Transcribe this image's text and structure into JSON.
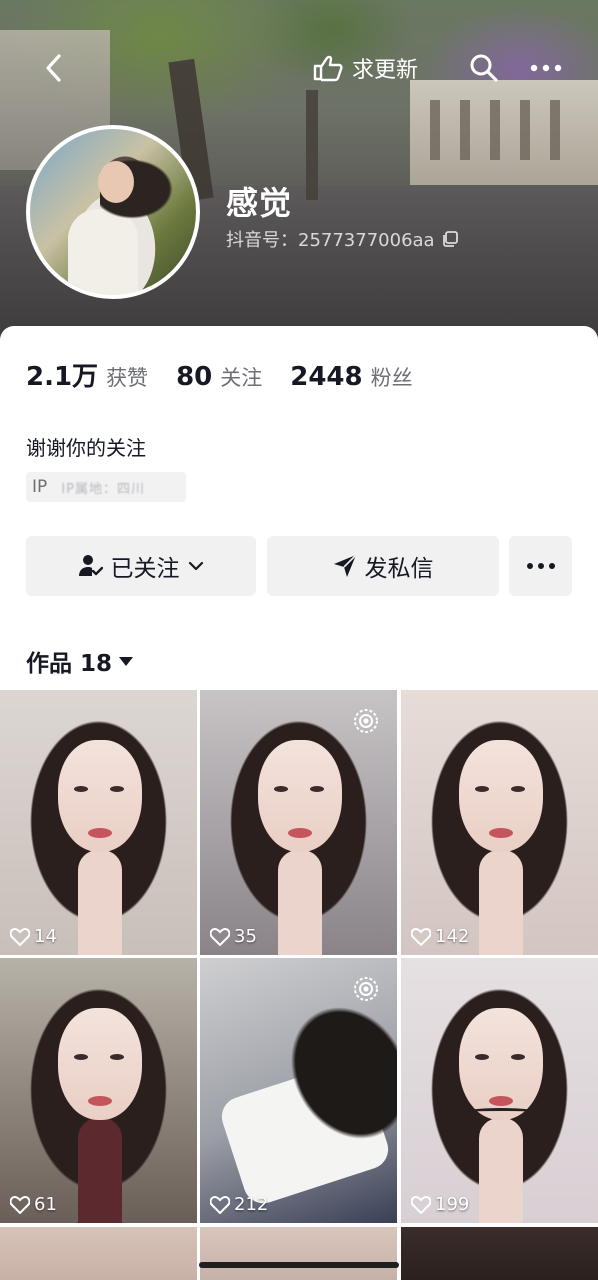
{
  "header": {
    "request_update_label": "求更新"
  },
  "profile": {
    "nickname": "感觉",
    "douyin_id": "抖音号：2577377006aa",
    "stats": [
      {
        "value": "2.1万",
        "label": "获赞"
      },
      {
        "value": "80",
        "label": "关注"
      },
      {
        "value": "2448",
        "label": "粉丝"
      }
    ],
    "signature": "谢谢你的关注",
    "ip_label": "IP",
    "ip_value": "IP属地：四川"
  },
  "actions": {
    "follow_label": "已关注",
    "message_label": "发私信"
  },
  "works": {
    "tab_label": "作品 18"
  },
  "videos": [
    {
      "likes": "14"
    },
    {
      "likes": "35"
    },
    {
      "likes": "142"
    },
    {
      "likes": "61"
    },
    {
      "likes": "212"
    },
    {
      "likes": "199"
    }
  ],
  "icons": {
    "back": "back-arrow-icon",
    "request_update": "pointing-hand-icon",
    "search": "search-icon",
    "more": "more-horizontal-icon",
    "copy": "copy-icon",
    "followed": "user-check-icon",
    "send": "send-icon",
    "heart": "heart-icon",
    "live": "live-ring-icon"
  }
}
